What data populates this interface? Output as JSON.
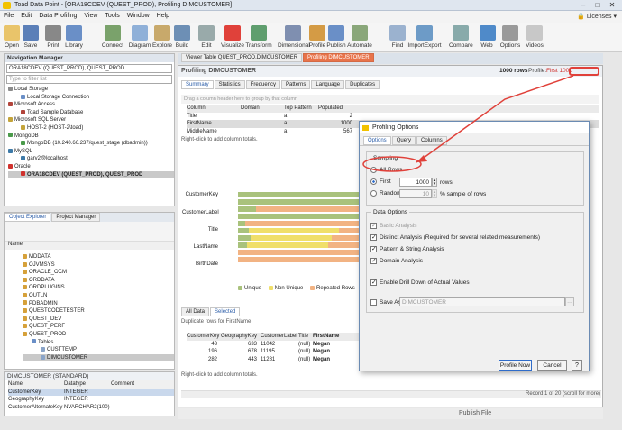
{
  "app": {
    "title": "Toad Data Point - [ORA18CDEV (QUEST_PROD), Profiling DIMCUSTOMER]",
    "licenses": "Licenses"
  },
  "menu": [
    "File",
    "Edit",
    "Data Profiling",
    "View",
    "Tools",
    "Window",
    "Help"
  ],
  "toolbar": [
    "Open",
    "Save",
    "Print",
    "Library",
    "Connect",
    "Diagram",
    "Explore",
    "Build",
    "Edit",
    "Visualize",
    "Transform",
    "Dimensional",
    "Profile",
    "Publish",
    "Automate",
    "Find",
    "ImportExport",
    "Compare",
    "Web",
    "Options",
    "Videos"
  ],
  "nav": {
    "title": "Navigation Manager",
    "connection": "ORA18CDEV (QUEST_PROD), QUEST_PROD",
    "filter": "Type to filter list",
    "tree": [
      "Local Storage",
      "Local Storage Connection",
      "Microsoft Access",
      "Toad Sample Database",
      "Microsoft SQL Server",
      "HOST-2 (HOST-2\\toad)",
      "MongoDB",
      "MongoDB (10.240.66.237/quest_stage (dbadmin))",
      "MySQL",
      "garv2@localhost",
      "Oracle",
      "ORA18CDEV (QUEST_PROD), QUEST_PROD"
    ]
  },
  "objects": {
    "tabs": [
      "Object Explorer",
      "Project Manager"
    ],
    "col": "Name",
    "items": [
      "MDDATA",
      "OJVMSYS",
      "ORACLE_OCM",
      "ORDDATA",
      "ORDPLUGINS",
      "OUTLN",
      "PDBADMIN",
      "QUESTCODETESTER",
      "QUEST_DEV",
      "QUEST_PERF",
      "QUEST_PROD",
      "Tables",
      "CUSTTEMP",
      "DIMCUSTOMER"
    ]
  },
  "info": {
    "title": "DIMCUSTOMER (STANDARD)",
    "headers": [
      "Name",
      "Datatype",
      "Comment"
    ],
    "rows": [
      [
        "CustomerKey",
        "INTEGER"
      ],
      [
        "GeographyKey",
        "INTEGER"
      ],
      [
        "CustomerAlternateKey",
        "NVARCHAR2(100)"
      ]
    ]
  },
  "doctabs": [
    "Viewer Table QUEST_PROD.DIMCUSTOMER",
    "Profiling DIMCUSTOMER"
  ],
  "profiling": {
    "title": "Profiling DIMCUSTOMER",
    "rows": "1000 rows",
    "profile_label": "Profile:",
    "profile_value": "First 1000",
    "tabs": [
      "Summary",
      "Statistics",
      "Frequency",
      "Patterns",
      "Language",
      "Duplicates"
    ],
    "group_hint": "Drag a column header here to group by that column",
    "grid_headers": [
      "Column",
      "Domain",
      "Top Pattern",
      "Populated"
    ],
    "grid_rows": [
      [
        "Title",
        "",
        "a",
        "2"
      ],
      [
        "FirstName",
        "",
        "a",
        "1000"
      ],
      [
        "MiddleName",
        "",
        "a",
        "567"
      ]
    ],
    "right_click": "Right-click to add column totals.",
    "chart_labels": [
      "CustomerKey",
      "CustomerLabel",
      "Title",
      "LastName",
      "BirthDate"
    ],
    "legend": [
      "Unique",
      "Non Unique",
      "Repeated Rows"
    ],
    "lower_tabs": [
      "All Data",
      "Selected"
    ],
    "dup_title": "Duplicate rows for FirstName",
    "dup_headers": [
      "CustomerKey",
      "GeographyKey",
      "CustomerLabel",
      "Title",
      "FirstName"
    ],
    "dup_rows": [
      [
        "43",
        "633",
        "11042",
        "(null)",
        "Megan"
      ],
      [
        "196",
        "678",
        "11195",
        "(null)",
        "Megan"
      ],
      [
        "282",
        "443",
        "11281",
        "(null)",
        "Megan"
      ]
    ],
    "right_click2": "Right-click to add column totals.",
    "record": "Record 1 of 20 (scroll for more)",
    "publish": "Publish File"
  },
  "dialog": {
    "title": "Profiling Options",
    "tabs": [
      "Options",
      "Query",
      "Columns"
    ],
    "sampling": "Sampling",
    "all_rows": "All Rows",
    "first": "First",
    "first_value": "1000",
    "rows": "rows",
    "random": "Random",
    "random_value": "10",
    "percent": "% sample of rows",
    "data_options": "Data Options",
    "basic": "Basic Analysis",
    "distinct": "Distinct Analysis (Required for several related measurements)",
    "pattern": "Pattern & String Analysis",
    "domain": "Domain Analysis",
    "drill": "Enable Drill Down of Actual Values",
    "save_as": "Save As",
    "save_value": "DIMCUSTOMER",
    "profile_now": "Profile Now",
    "cancel": "Cancel"
  },
  "colors": {
    "unique": "#a9c27c",
    "non_unique": "#f0df6a",
    "repeated": "#f2b383",
    "accent": "#e0413a"
  }
}
